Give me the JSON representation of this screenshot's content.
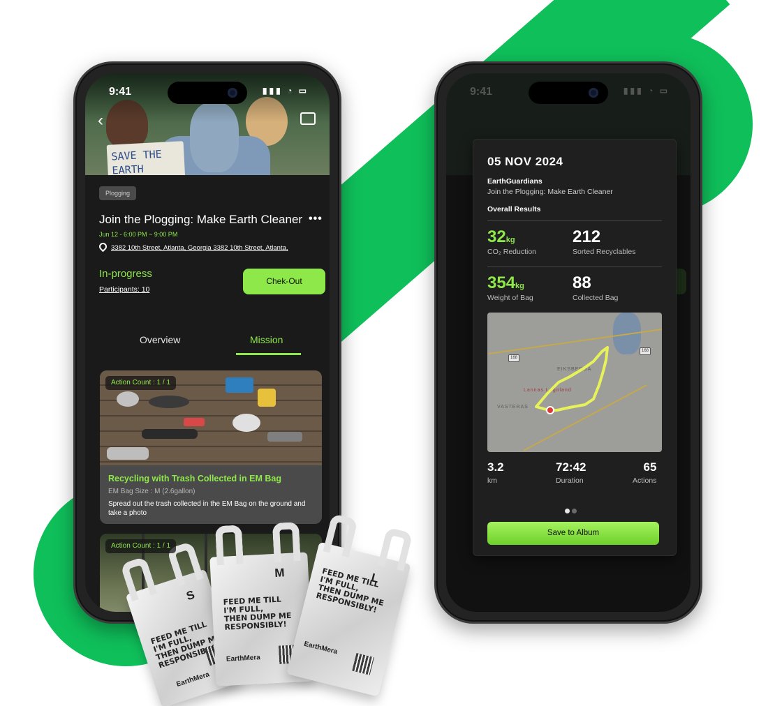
{
  "colors": {
    "brand_green": "#0fbf5a",
    "accent_lime": "#8ee84a",
    "screen_bg": "#1a1a1a",
    "card_bg": "#4a4a4a"
  },
  "status_bar": {
    "time": "9:41",
    "icons": "signal-icon wifi-icon battery-icon"
  },
  "left_screen": {
    "hero_sign_text": "SAVE THE\nEARTH",
    "category_chip": "Plogging",
    "event": {
      "title": "Join the Plogging: Make Earth Cleaner",
      "more_label": "•••",
      "date_time": "Jun 12 - 6:00 PM ~ 9:00 PM",
      "address": "3382 10th Street, Atlanta, Georgia 3382 10th Street, Atlanta,",
      "status": "In-progress",
      "participants": "Participants: 10",
      "checkout_label": "Chek-Out"
    },
    "tabs": [
      {
        "label": "Overview",
        "active": false
      },
      {
        "label": "Mission",
        "active": true
      }
    ],
    "missions": [
      {
        "count": "Action Count : 1 / 1",
        "title": "Recycling with Trash Collected in EM Bag",
        "bag_size": "EM Bag Size : M (2.6gallon)",
        "description": "Spread out the trash collected in the EM Bag on the ground and take a photo"
      },
      {
        "count": "Action Count : 1 / 1"
      }
    ]
  },
  "bags": {
    "slogan": "FEED ME TILL\nI'M FULL,\nTHEN DUMP ME\nRESPONSIBLY!",
    "brand": "EarthMera",
    "sizes": [
      "S",
      "M",
      "L"
    ]
  },
  "right_screen": {
    "result": {
      "date": "05 NOV 2024",
      "organization": "EarthGuardians",
      "event_title": "Join the Plogging: Make Earth Cleaner",
      "section_title": "Overall Results",
      "stats": {
        "co2": {
          "value": "32",
          "unit": "kg",
          "label": "CO₂ Reduction"
        },
        "sorted": {
          "value": "212",
          "label": "Sorted Recyclables"
        },
        "weight": {
          "value": "354",
          "unit": "kg",
          "label": "Weight of Bag"
        },
        "bags": {
          "value": "88",
          "label": "Collected Bag"
        }
      },
      "map": {
        "road_shield_1": "168",
        "road_shield_2": "168",
        "place_1": "EIKSBERGA",
        "place_2": "Lannas Legoland",
        "place_3": "VASTERAS"
      },
      "summary": {
        "distance": {
          "value": "3.2",
          "label": "km"
        },
        "duration": {
          "value": "72:42",
          "label": "Duration"
        },
        "actions": {
          "value": "65",
          "label": "Actions"
        }
      },
      "pagination": {
        "current": 1,
        "total": 2
      },
      "save_label": "Save to Album"
    }
  }
}
